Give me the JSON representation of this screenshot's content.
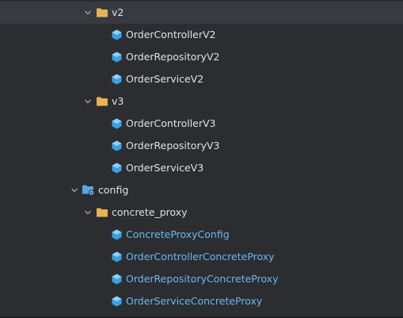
{
  "colors": {
    "background": "#2b2d30",
    "selected_row": "#373a40",
    "folder": "#e7b356",
    "class_icon": "#3aa0e6",
    "text_default": "#dfe1e5",
    "text_config_class": "#6cb8f0"
  },
  "tree": {
    "folder_v2": {
      "label": "v2",
      "icon": "folder-icon",
      "expanded": true
    },
    "v2_item_1": {
      "label": "OrderControllerV2",
      "icon": "class-icon"
    },
    "v2_item_2": {
      "label": "OrderRepositoryV2",
      "icon": "class-icon"
    },
    "v2_item_3": {
      "label": "OrderServiceV2",
      "icon": "class-icon"
    },
    "folder_v3": {
      "label": "v3",
      "icon": "folder-icon",
      "expanded": true
    },
    "v3_item_1": {
      "label": "OrderControllerV3",
      "icon": "class-icon"
    },
    "v3_item_2": {
      "label": "OrderRepositoryV3",
      "icon": "class-icon"
    },
    "v3_item_3": {
      "label": "OrderServiceV3",
      "icon": "class-icon"
    },
    "folder_config": {
      "label": "config",
      "icon": "config-package-icon",
      "expanded": true
    },
    "folder_concrete_proxy": {
      "label": "concrete_proxy",
      "icon": "folder-icon",
      "expanded": true
    },
    "cp_item_1": {
      "label": "ConcreteProxyConfig",
      "icon": "class-icon"
    },
    "cp_item_2": {
      "label": "OrderControllerConcreteProxy",
      "icon": "class-icon"
    },
    "cp_item_3": {
      "label": "OrderRepositoryConcreteProxy",
      "icon": "class-icon"
    },
    "cp_item_4": {
      "label": "OrderServiceConcreteProxy",
      "icon": "class-icon"
    }
  }
}
